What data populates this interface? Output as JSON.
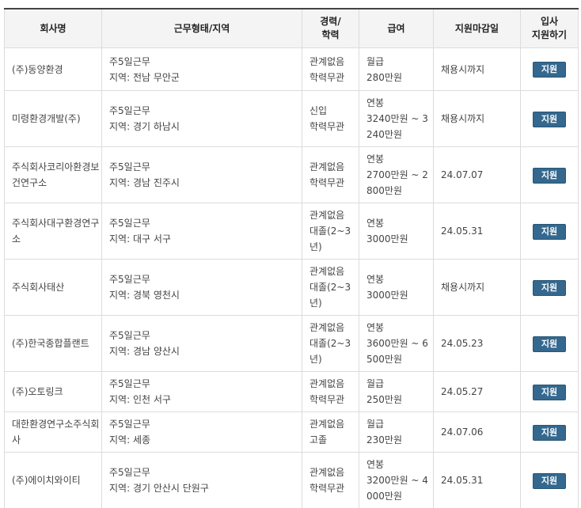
{
  "header": {
    "company": "회사명",
    "work_type": "근무형태/지역",
    "career_line1": "경력/",
    "career_line2": "학력",
    "salary": "급여",
    "deadline": "지원마감일",
    "apply_line1": "입사",
    "apply_line2": "지원하기"
  },
  "apply_label": "지원",
  "rows": [
    {
      "company": "(주)동양환경",
      "work_type": "주5일근무",
      "region": "지역: 전남 무안군",
      "career": "관계없음",
      "education": "학력무관",
      "salary_type": "월급",
      "salary": "280만원",
      "deadline": "채용시까지"
    },
    {
      "company": "미령환경개발(주)",
      "work_type": "주5일근무",
      "region": "지역: 경기 하남시",
      "career": "신입",
      "education": "학력무관",
      "salary_type": "연봉",
      "salary": "3240만원 ~ 3240만원",
      "deadline": "채용시까지"
    },
    {
      "company": "주식회사코리아환경보건연구소",
      "work_type": "주5일근무",
      "region": "지역: 경남 진주시",
      "career": "관계없음",
      "education": "학력무관",
      "salary_type": "연봉",
      "salary": "2700만원 ~ 2800만원",
      "deadline": "24.07.07"
    },
    {
      "company": "주식회사대구환경연구소",
      "work_type": "주5일근무",
      "region": "지역: 대구 서구",
      "career": "관계없음",
      "education": "대졸(2~3년)",
      "salary_type": "연봉",
      "salary": "3000만원",
      "deadline": "24.05.31"
    },
    {
      "company": "주식회사태산",
      "work_type": "주5일근무",
      "region": "지역: 경북 영천시",
      "career": "관계없음",
      "education": "대졸(2~3년)",
      "salary_type": "연봉",
      "salary": "3000만원",
      "deadline": "채용시까지"
    },
    {
      "company": "(주)한국종합플랜트",
      "work_type": "주5일근무",
      "region": "지역: 경남 양산시",
      "career": "관계없음",
      "education": "대졸(2~3년)",
      "salary_type": "연봉",
      "salary": "3600만원 ~ 6500만원",
      "deadline": "24.05.23"
    },
    {
      "company": "(주)오토링크",
      "work_type": "주5일근무",
      "region": "지역: 인천 서구",
      "career": "관계없음",
      "education": "학력무관",
      "salary_type": "월급",
      "salary": "250만원",
      "deadline": "24.05.27"
    },
    {
      "company": "대한환경연구소주식회사",
      "work_type": "주5일근무",
      "region": "지역: 세종",
      "career": "관계없음",
      "education": "고졸",
      "salary_type": "월급",
      "salary": "230만원",
      "deadline": "24.07.06"
    },
    {
      "company": "(주)에이치와이티",
      "work_type": "주5일근무",
      "region": "지역: 경기 안산시 단원구",
      "career": "관계없음",
      "education": "학력무관",
      "salary_type": "연봉",
      "salary": "3200만원 ~ 4000만원",
      "deadline": "24.05.31"
    }
  ]
}
